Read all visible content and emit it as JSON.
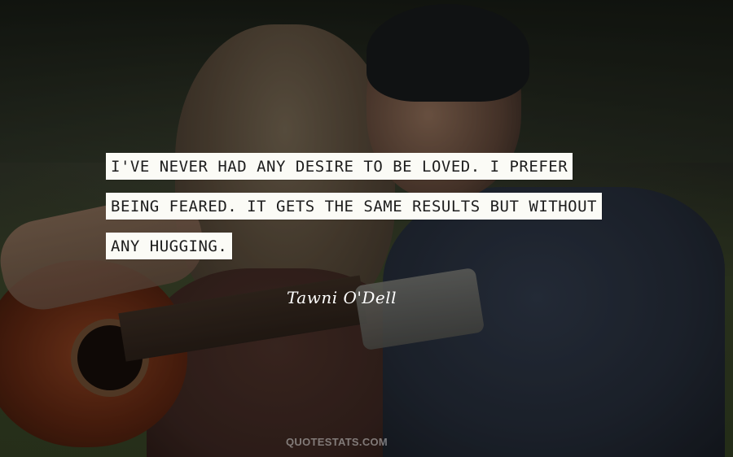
{
  "quote": {
    "lines": [
      "I'VE NEVER HAD ANY DESIRE TO BE LOVED. I PREFER",
      "BEING FEARED. IT GETS THE SAME RESULTS BUT WITHOUT",
      "ANY HUGGING."
    ]
  },
  "author": "Tawni O'Dell",
  "watermark": "QUOTESTATS.COM",
  "colors": {
    "quote_bg": "#fbfbf6",
    "quote_text": "#1d1d1d",
    "author_text": "#ffffff"
  }
}
